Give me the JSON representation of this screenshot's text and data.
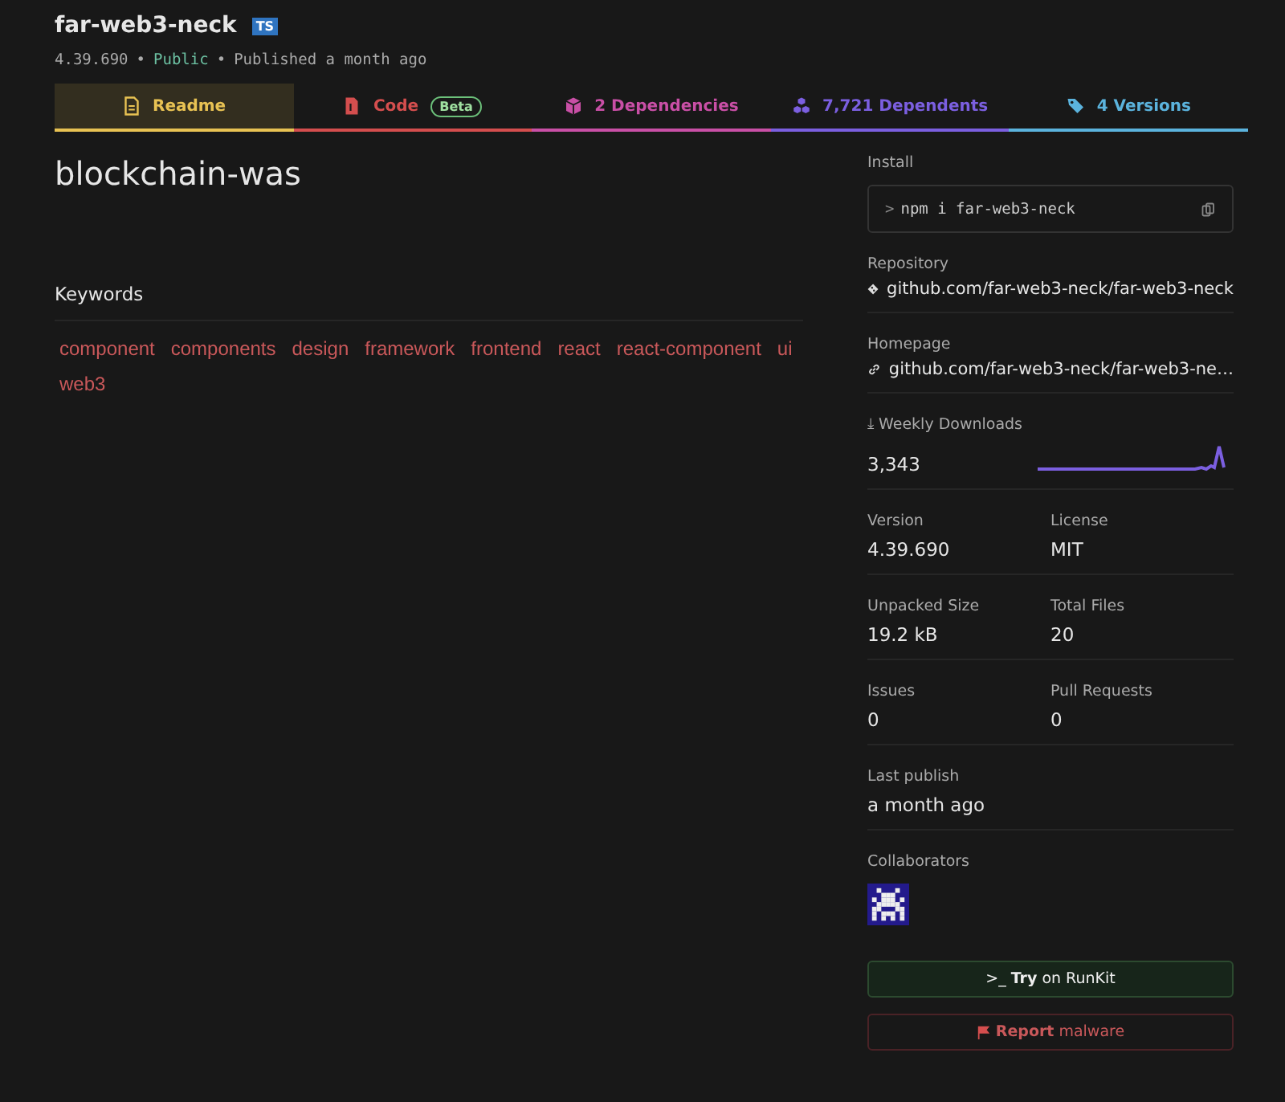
{
  "package": {
    "name": "far-web3-neck",
    "ts_badge": "TS",
    "version": "4.39.690",
    "separator_1": "•",
    "visibility": "Public",
    "separator_2": "•",
    "published": "Published a month ago"
  },
  "tabs": [
    {
      "label": "Readme",
      "selected": true,
      "color": "#e8c253",
      "kind": "readme"
    },
    {
      "label": "Code",
      "selected": false,
      "color": "#d44e4e",
      "kind": "code",
      "badge": "Beta"
    },
    {
      "label": "2 Dependencies",
      "selected": false,
      "color": "#c94fa6",
      "kind": "dependencies"
    },
    {
      "label": "7,721 Dependents",
      "selected": false,
      "color": "#7b5fe0",
      "kind": "dependents"
    },
    {
      "label": "4 Versions",
      "selected": false,
      "color": "#5bb3dd",
      "kind": "versions"
    }
  ],
  "readme": {
    "heading": "blockchain-was",
    "keywords_title": "Keywords",
    "keywords": [
      "component",
      "components",
      "design",
      "framework",
      "frontend",
      "react",
      "react-component",
      "ui",
      "web3"
    ]
  },
  "sidebar": {
    "install_label": "Install",
    "install_prompt": ">",
    "install_command": "npm i far-web3-neck",
    "repository_label": "Repository",
    "repository": "github.com/far-web3-neck/far-web3-neck",
    "homepage_label": "Homepage",
    "homepage": "github.com/far-web3-neck/far-web3-ne…",
    "downloads_icon": "⤓",
    "downloads_label": "Weekly Downloads",
    "downloads": "3,343",
    "stats": [
      [
        {
          "label": "Version",
          "value": "4.39.690"
        },
        {
          "label": "License",
          "value": "MIT"
        }
      ],
      [
        {
          "label": "Unpacked Size",
          "value": "19.2 kB"
        },
        {
          "label": "Total Files",
          "value": "20"
        }
      ],
      [
        {
          "label": "Issues",
          "value": "0"
        },
        {
          "label": "Pull Requests",
          "value": "0"
        }
      ]
    ],
    "last_publish_label": "Last publish",
    "last_publish": "a month ago",
    "collaborators_label": "Collaborators",
    "runkit_prompt": ">_",
    "runkit_bold": "Try",
    "runkit_rest": "on RunKit",
    "report_bold": "Report",
    "report_rest": "malware"
  }
}
